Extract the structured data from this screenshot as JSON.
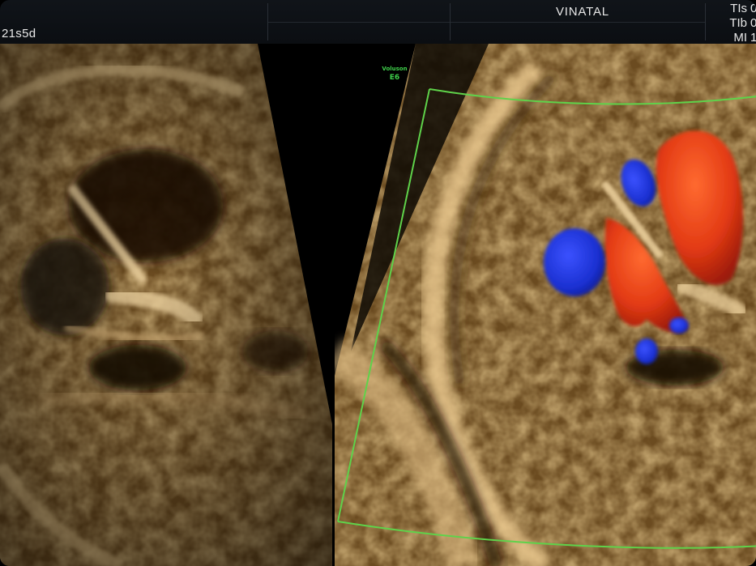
{
  "topbar": {
    "gestational_age": "21s5d",
    "clinic_name": "VINATAL",
    "indices": [
      {
        "label": "TIs",
        "value": "0"
      },
      {
        "label": "TIb",
        "value": "0"
      },
      {
        "label": "MI",
        "value": "1."
      }
    ]
  },
  "logo": {
    "line1": "Voluson",
    "line2": "E6"
  },
  "colors": {
    "tissue_base": "#6e4e22",
    "tissue_bright": "#e8c489",
    "doppler_red": "#e23a14",
    "doppler_blue": "#1a2fd0",
    "sector_outline": "#5fd24a",
    "logo_green": "#3ecf4a"
  }
}
